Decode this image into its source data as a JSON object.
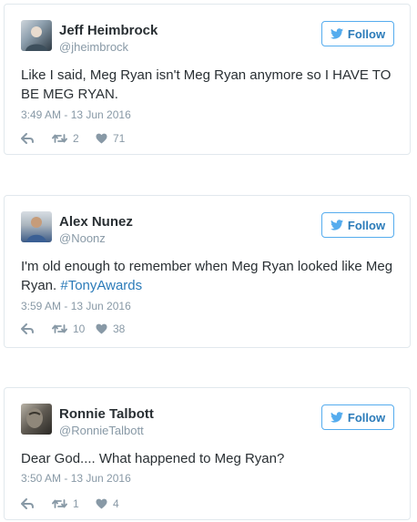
{
  "tweets": [
    {
      "name": "Jeff Heimbrock",
      "handle": "@jheimbrock",
      "follow_label": "Follow",
      "text_parts": [
        "Like I said, Meg Ryan isn't Meg Ryan anymore so I HAVE TO BE MEG RYAN."
      ],
      "hashtag": "",
      "timestamp": "3:49 AM - 13 Jun 2016",
      "retweets": "2",
      "likes": "71"
    },
    {
      "name": "Alex Nunez",
      "handle": "@Noonz",
      "follow_label": "Follow",
      "text_parts": [
        "I'm old enough to remember when Meg Ryan looked like Meg Ryan. "
      ],
      "hashtag": "#TonyAwards",
      "timestamp": "3:59 AM - 13 Jun 2016",
      "retweets": "10",
      "likes": "38"
    },
    {
      "name": "Ronnie Talbott",
      "handle": "@RonnieTalbott",
      "follow_label": "Follow",
      "text_parts": [
        "Dear God.... What happened to Meg Ryan?"
      ],
      "hashtag": "",
      "timestamp": "3:50 AM - 13 Jun 2016",
      "retweets": "1",
      "likes": "4"
    }
  ],
  "icons": {
    "bird": "twitter-bird-icon",
    "reply": "reply-icon",
    "retweet": "retweet-icon",
    "like": "heart-icon"
  },
  "colors": {
    "accent": "#2b7bb9",
    "follow_border": "#55acee",
    "muted": "#8899a6",
    "text": "#292f33",
    "card_border": "#e1e8ed"
  }
}
